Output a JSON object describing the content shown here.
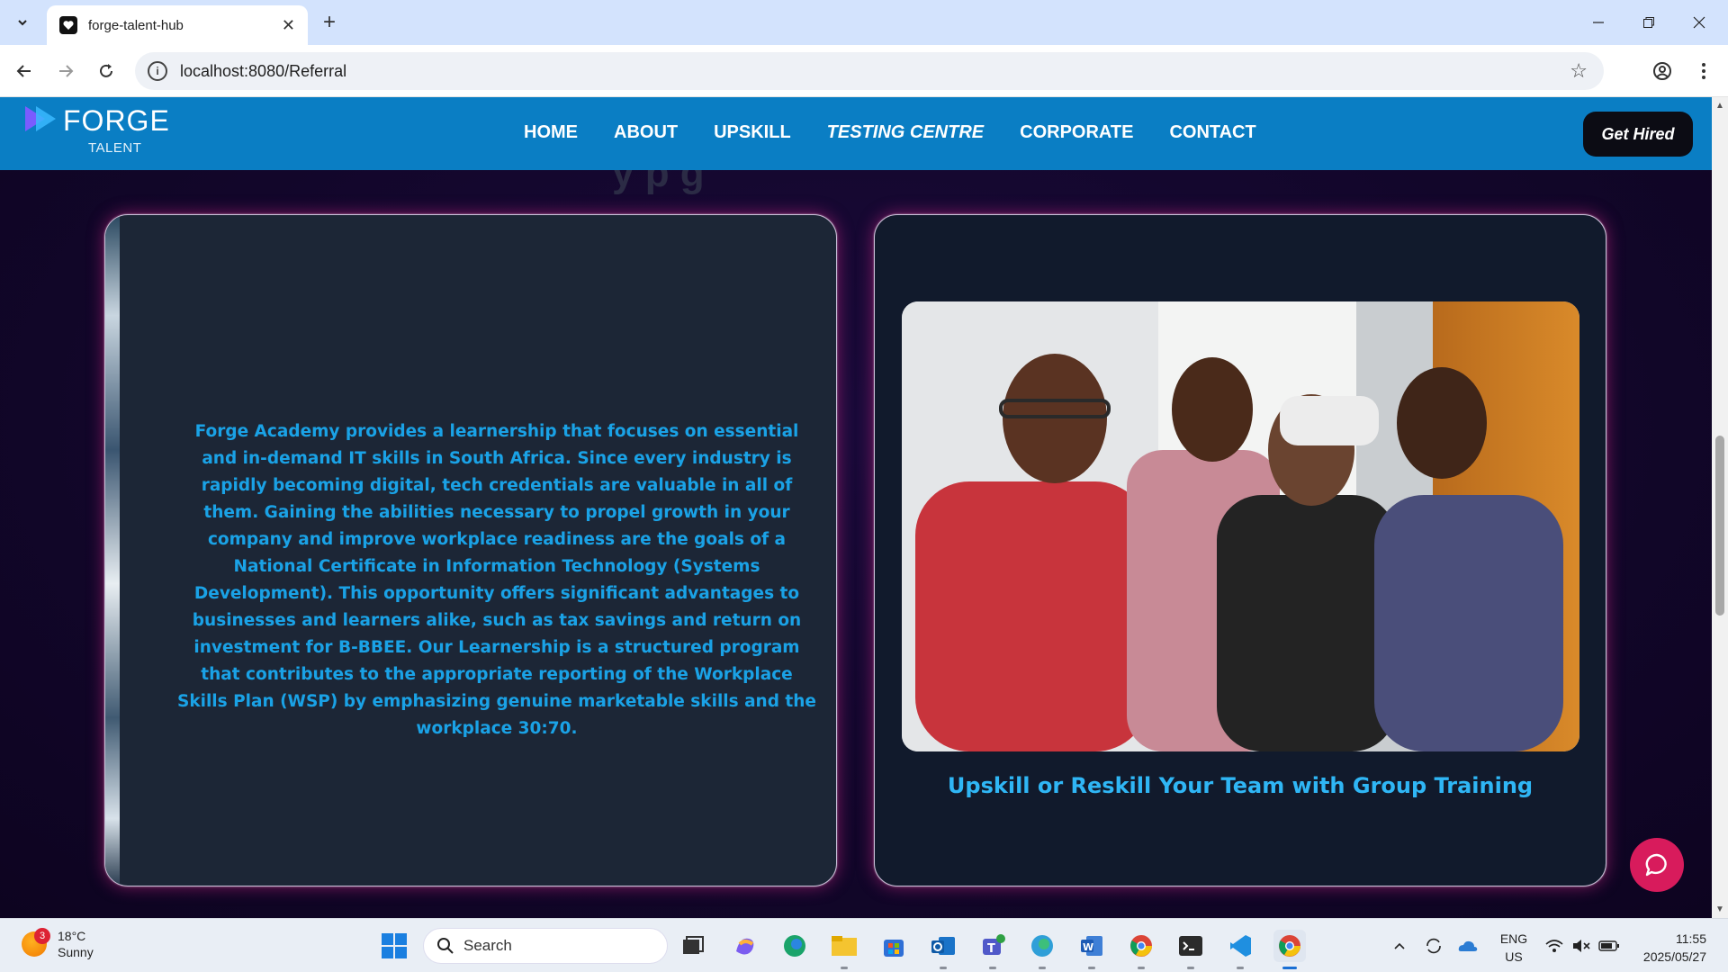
{
  "browser": {
    "tab_title": "forge-talent-hub",
    "url": "localhost:8080/Referral",
    "new_tab_symbol": "+",
    "close_symbol": "✕"
  },
  "site": {
    "logo_word": "FORGE",
    "logo_sub": "TALENT",
    "menu": [
      "HOME",
      "ABOUT",
      "UPSKILL",
      "TESTING CENTRE",
      "CORPORATE",
      "CONTACT"
    ],
    "cta": "Get Hired",
    "bg_heading": "y      p                  g"
  },
  "cards": {
    "left_text": "Forge Academy provides a learnership that focuses on essential and in-demand IT skills in South Africa. Since every industry is rapidly becoming digital, tech credentials are valuable in all of them. Gaining the abilities necessary to propel growth in your company and improve workplace readiness are the goals of a National Certificate in Information Technology (Systems Development). This opportunity offers significant advantages to businesses and learners alike, such as tax savings and return on investment for B-BBEE. Our Learnership is a structured program that contributes to the appropriate reporting of the Workplace Skills Plan (WSP) by emphasizing genuine marketable skills and the workplace 30:70.",
    "right_caption": "Upskill or Reskill Your Team with Group Training"
  },
  "taskbar": {
    "weather_temp": "18°C",
    "weather_cond": "Sunny",
    "weather_badge": "3",
    "search_placeholder": "Search",
    "lang_top": "ENG",
    "lang_bottom": "US",
    "time": "11:55",
    "date": "2025/05/27"
  },
  "colors": {
    "nav_bg": "#0a7ec4",
    "text_blue": "#1aa2e6",
    "chat_button": "#d81b5c"
  }
}
